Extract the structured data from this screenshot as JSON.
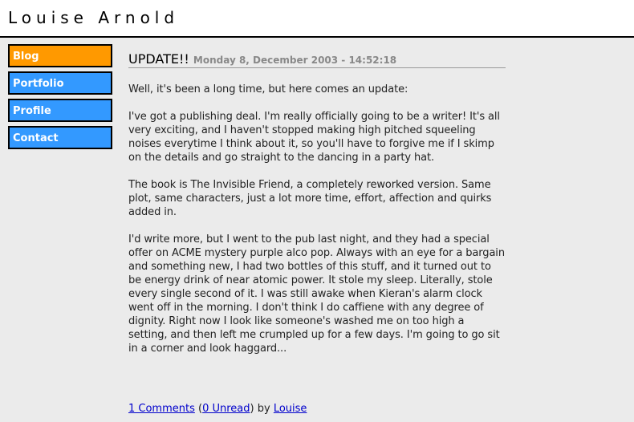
{
  "site": {
    "title": "Louise Arnold"
  },
  "nav": {
    "items": [
      {
        "label": "Blog",
        "active": true
      },
      {
        "label": "Portfolio",
        "active": false
      },
      {
        "label": "Profile",
        "active": false
      },
      {
        "label": "Contact",
        "active": false
      }
    ]
  },
  "post": {
    "title": "UPDATE!!",
    "date": "Monday 8, December 2003 - 14:52:18",
    "paragraphs": [
      "Well, it's been a long time, but here comes an update:",
      "I've got a publishing deal. I'm really officially going to be a writer! It's all very exciting, and I haven't stopped making high pitched squeeling noises everytime I think about it, so you'll have to forgive me if I skimp on the details and go straight to the dancing in a party hat.",
      "The book is The Invisible Friend, a completely reworked version. Same plot, same characters, just a lot more time, effort, affection and quirks added in.",
      "I'd write more, but I went to the pub last night, and they had a special offer on ACME mystery purple alco pop. Always with an eye for a bargain and something new, I had two bottles of this stuff, and it turned out to be energy drink of near atomic power. It stole my sleep. Literally, stole every single second of it. I was still awake when Kieran's alarm clock went off in the morning. I don't think I do caffiene with any degree of dignity. Right now I look like someone's washed me on too high a setting, and then left me crumpled up for a few days. I'm going to go sit in a corner and look haggard..."
    ],
    "footer": {
      "comments_link": "1 Comments",
      "open_paren": "(",
      "unread_link": "0 Unread",
      "close_by": ") by",
      "author_link": "Louise"
    }
  },
  "colors": {
    "nav_active": "#ff9900",
    "nav_inactive": "#3399ff",
    "background": "#ebebeb",
    "link": "#0000cc"
  }
}
